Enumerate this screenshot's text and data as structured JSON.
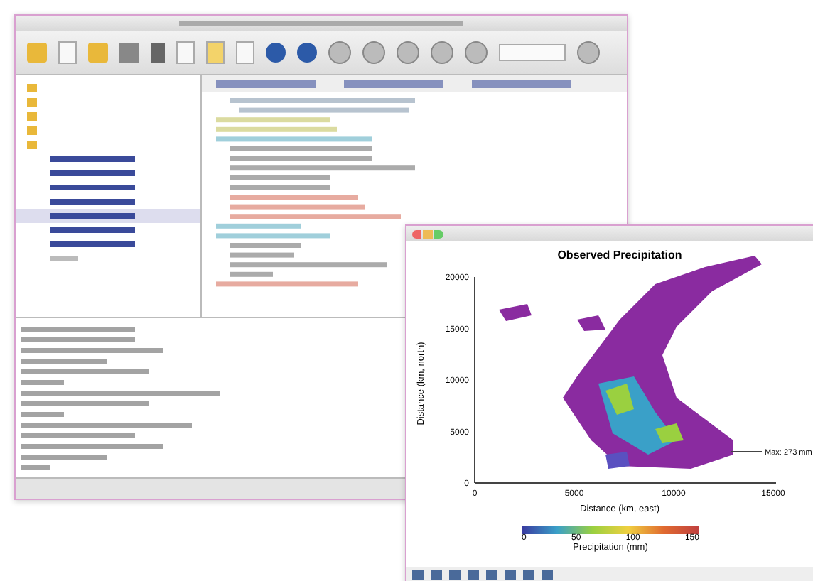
{
  "tree": {
    "items": [
      {
        "kind": "folder",
        "selected": false
      },
      {
        "kind": "folder",
        "selected": false
      },
      {
        "kind": "folder",
        "selected": false
      },
      {
        "kind": "folder",
        "selected": false
      },
      {
        "kind": "folder",
        "selected": false
      },
      {
        "kind": "file",
        "selected": false
      },
      {
        "kind": "file",
        "selected": false
      },
      {
        "kind": "file",
        "selected": false
      },
      {
        "kind": "file",
        "selected": false
      },
      {
        "kind": "file",
        "selected": true
      },
      {
        "kind": "file",
        "selected": false
      },
      {
        "kind": "file",
        "selected": false
      },
      {
        "kind": "doc",
        "selected": false
      }
    ]
  },
  "plot": {
    "title": "Observed Precipitation",
    "xlabel": "Distance (km, east)",
    "ylabel": "Distance (km, north)",
    "xticks": [
      "0",
      "5000",
      "10000",
      "15000"
    ],
    "yticks": [
      "20000",
      "15000",
      "10000",
      "5000",
      "0"
    ],
    "annotation": "Max: 273 mm",
    "colorbar": {
      "label": "Precipitation (mm)",
      "ticks": [
        "0",
        "50",
        "100",
        "150"
      ]
    }
  }
}
